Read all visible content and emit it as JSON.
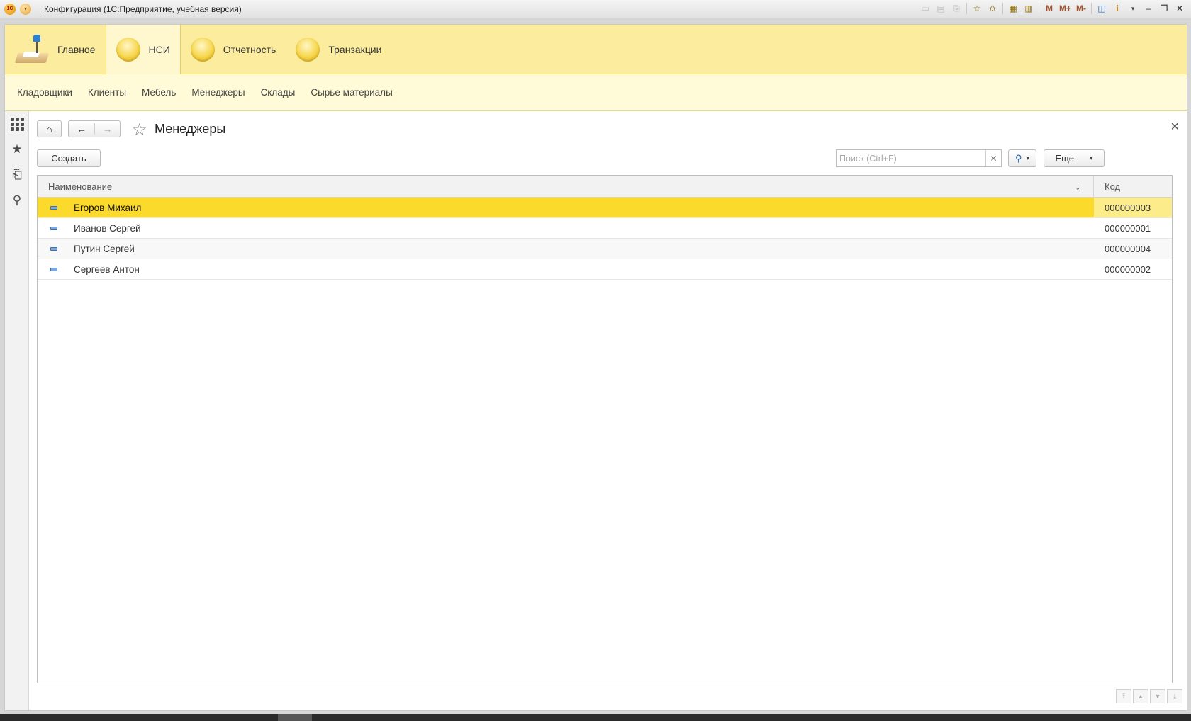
{
  "titlebar": {
    "title": "Конфигурация  (1С:Предприятие, учебная версия)",
    "logo_text": "1C",
    "tools": {
      "m": "M",
      "m_plus": "M+",
      "m_minus": "M-",
      "info": "i"
    }
  },
  "sections": [
    {
      "label": "Главное",
      "icon": "desk-lamp-icon"
    },
    {
      "label": "НСИ",
      "icon": "yellow-circle-icon",
      "active": true
    },
    {
      "label": "Отчетность",
      "icon": "yellow-circle-icon"
    },
    {
      "label": "Транзакции",
      "icon": "yellow-circle-icon"
    }
  ],
  "subnav": [
    {
      "label": "Кладовщики"
    },
    {
      "label": "Клиенты"
    },
    {
      "label": "Мебель"
    },
    {
      "label": "Менеджеры"
    },
    {
      "label": "Склады"
    },
    {
      "label": "Сырье материалы"
    }
  ],
  "form": {
    "title": "Менеджеры",
    "create_label": "Создать",
    "search_placeholder": "Поиск (Ctrl+F)",
    "more_label": "Еще"
  },
  "table": {
    "columns": [
      "Наименование",
      "Код"
    ],
    "sort_indicator": "↓",
    "rows": [
      {
        "name": "Егоров Михаил",
        "code": "000000003",
        "selected": true
      },
      {
        "name": "Иванов Сергей",
        "code": "000000001"
      },
      {
        "name": "Путин Сергей",
        "code": "000000004"
      },
      {
        "name": "Сергеев Антон",
        "code": "000000002"
      }
    ]
  },
  "colors": {
    "section_bar": "#fbec9e",
    "subnav_bar": "#fffbd8",
    "selected_row": "#fbda2c"
  }
}
